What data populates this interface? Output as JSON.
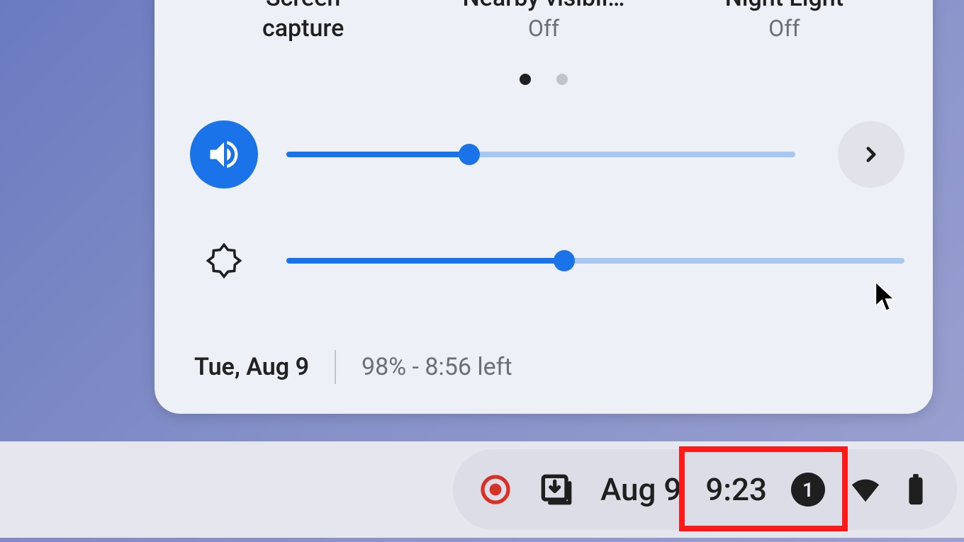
{
  "panel": {
    "toggles": [
      {
        "label": "Screen\ncapture",
        "sub": ""
      },
      {
        "label": "Nearby visibil…",
        "sub": "Off"
      },
      {
        "label": "Night Light",
        "sub": "Off"
      }
    ],
    "pagination": {
      "active_index": 0,
      "count": 2
    },
    "volume": {
      "percent": 36
    },
    "brightness": {
      "percent": 45
    },
    "date": "Tue, Aug 9",
    "battery_text": "98% - 8:56 left"
  },
  "shelf": {
    "date": "Aug 9",
    "time": "9:23",
    "notification_count": "1"
  }
}
